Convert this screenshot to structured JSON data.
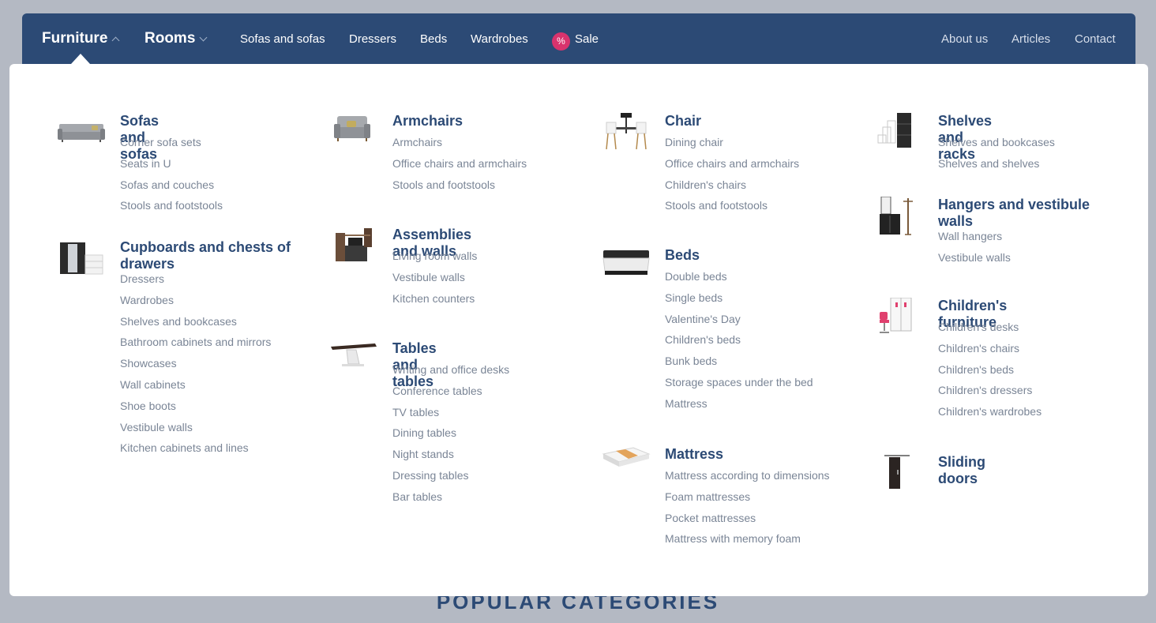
{
  "nav": {
    "main": [
      {
        "label": "Furniture"
      },
      {
        "label": "Rooms"
      }
    ],
    "links": [
      "Sofas and sofas",
      "Dressers",
      "Beds",
      "Wardrobes"
    ],
    "sale": {
      "badge": "%",
      "label": "Sale"
    },
    "right": [
      "About us",
      "Articles",
      "Contact"
    ]
  },
  "menu": {
    "col1": [
      {
        "title": "Sofas and sofas",
        "image": "sofa-icon",
        "items": [
          "Corner sofa sets",
          "Seats in U",
          "Sofas and couches",
          "Stools and footstools"
        ]
      },
      {
        "title": "Cupboards and chests of drawers",
        "image": "wardrobe-icon",
        "items": [
          "Dressers",
          "Wardrobes",
          "Shelves and bookcases",
          "Bathroom cabinets and mirrors",
          "Showcases",
          "Wall cabinets",
          "Shoe boots",
          "Vestibule walls",
          "Kitchen cabinets and lines"
        ]
      }
    ],
    "col2": [
      {
        "title": "Armchairs",
        "image": "armchair-icon",
        "items": [
          "Armchairs",
          "Office chairs and armchairs",
          "Stools and footstools"
        ]
      },
      {
        "title": "Assemblies and walls",
        "image": "wall-unit-icon",
        "items": [
          "Living room walls",
          "Vestibule walls",
          "Kitchen counters"
        ]
      },
      {
        "title": "Tables and tables",
        "image": "table-icon",
        "items": [
          "Writing and office desks",
          "Conference tables",
          "TV tables",
          "Dining tables",
          "Night stands",
          "Dressing tables",
          "Bar tables"
        ]
      }
    ],
    "col3": [
      {
        "title": "Chair",
        "image": "chair-icon",
        "items": [
          "Dining chair",
          "Office chairs and armchairs",
          "Children's chairs",
          "Stools and footstools"
        ]
      },
      {
        "title": "Beds",
        "image": "bed-icon",
        "items": [
          "Double beds",
          "Single beds",
          "Valentine's Day",
          "Children's beds",
          "Bunk beds",
          "Storage spaces under the bed",
          "Mattress"
        ]
      },
      {
        "title": "Mattress",
        "image": "mattress-icon",
        "items": [
          "Mattress according to dimensions",
          "Foam mattresses",
          "Pocket mattresses",
          "Mattress with memory foam"
        ]
      }
    ],
    "col4": [
      {
        "title": "Shelves and racks",
        "image": "shelf-icon",
        "items": [
          "Shelves and bookcases",
          "Shelves and shelves"
        ]
      },
      {
        "title": "Hangers and vestibule walls",
        "image": "hanger-icon",
        "items": [
          "Wall hangers",
          "Vestibule walls"
        ]
      },
      {
        "title": "Children's furniture",
        "image": "kids-furniture-icon",
        "items": [
          "Children's desks",
          "Children's chairs",
          "Children's beds",
          "Children's dressers",
          "Children's wardrobes"
        ]
      },
      {
        "title": "Sliding doors",
        "image": "sliding-door-icon",
        "items": []
      }
    ]
  },
  "section": {
    "popular_title": "POPULAR CATEGORIES"
  },
  "colors": {
    "nav_bg": "#2c4a75",
    "sale_badge": "#d8336d",
    "heading": "#2c4a75",
    "link": "#7a8596"
  }
}
